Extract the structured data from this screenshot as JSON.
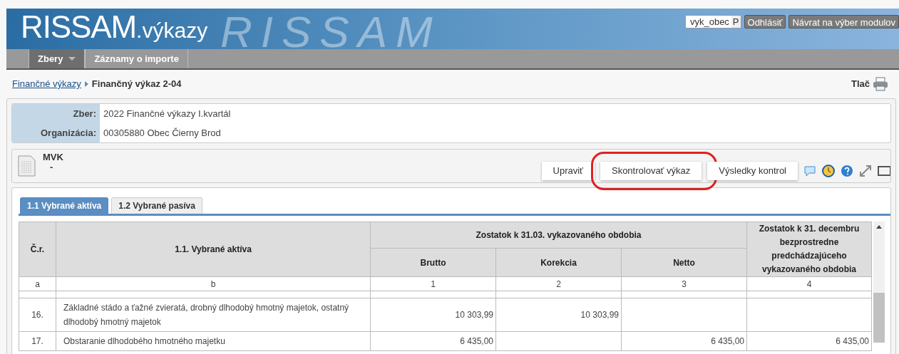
{
  "header": {
    "logo": "RISSAM",
    "logo_suffix": ".výkazy",
    "watermark": "RISSAM",
    "user_field": {
      "value": "vyk_obec",
      "suffix": "P"
    },
    "buttons": [
      "Odhlásiť",
      "Návrat na výber modulov"
    ]
  },
  "nav": [
    {
      "label": "Zbery",
      "selected": true,
      "dropdown": true
    },
    {
      "label": "Záznamy o importe",
      "selected": false,
      "dropdown": false
    }
  ],
  "breadcrumb": {
    "link": "Finančné výkazy",
    "current": "Finančný výkaz 2-04",
    "print": "Tlač"
  },
  "info": [
    {
      "label": "Zber:",
      "value": "2022 Finančné výkazy I.kvartál"
    },
    {
      "label": "Organizácia:",
      "value": "00305880 Obec Čierny Brod"
    }
  ],
  "report": {
    "title": "MVK",
    "subtitle": "-",
    "buttons": [
      {
        "label": "Upraviť",
        "highlighted": false
      },
      {
        "label": "Skontrolovať výkaz",
        "highlighted": true
      },
      {
        "label": "Výsledky kontrol",
        "highlighted": false
      }
    ]
  },
  "tabs": [
    {
      "label": "1.1 Vybrané aktíva",
      "selected": true
    },
    {
      "label": "1.2 Vybrané pasíva",
      "selected": false
    }
  ],
  "table": {
    "col_nr": "Č.r.",
    "col_name": "1.1. Vybrané aktíva",
    "group": "Zostatok k 31.03. vykazovaného obdobia",
    "sub_columns": [
      "Brutto",
      "Korekcia",
      "Netto"
    ],
    "col_prev": "Zostatok k 31. decembru bezprostredne predchádzajúceho vykazovaného obdobia",
    "index_row": [
      "a",
      "b",
      "1",
      "2",
      "3",
      "4"
    ],
    "rows": [
      {
        "nr": "16.",
        "name": "Základné stádo a ťažné zvieratá, drobný dlhodobý hmotný majetok, ostatný dlhodobý hmotný majetok",
        "values": {
          "brutto": "10 303,99",
          "korekcia": "10 303,99"
        }
      },
      {
        "nr": "17.",
        "name": "Obstaranie dlhodobého hmotného majetku",
        "values": {
          "brutto": "6 435,00",
          "netto": "6 435,00",
          "previous": "6 435,00"
        }
      }
    ]
  }
}
